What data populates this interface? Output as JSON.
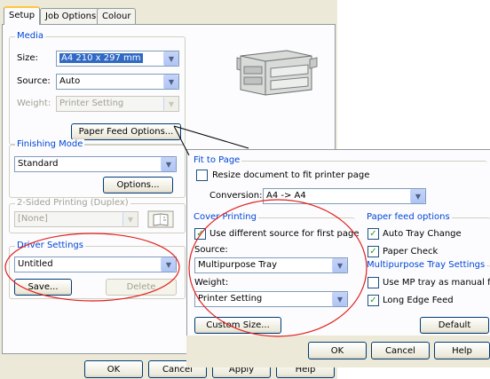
{
  "tabs": [
    {
      "label": "Setup",
      "active": true
    },
    {
      "label": "Job Options",
      "active": false
    },
    {
      "label": "Colour",
      "active": false
    }
  ],
  "media": {
    "group_label": "Media",
    "size_label": "Size:",
    "size_value": "A4 210 x 297 mm",
    "source_label": "Source:",
    "source_value": "Auto",
    "weight_label": "Weight:",
    "weight_value": "Printer Setting",
    "paper_feed_button": "Paper Feed Options..."
  },
  "finishing": {
    "group_label": "Finishing Mode",
    "value": "Standard",
    "options_button": "Options..."
  },
  "duplex": {
    "group_label": "2-Sided Printing (Duplex)",
    "value": "[None]"
  },
  "driver_settings": {
    "group_label": "Driver Settings",
    "value": "Untitled",
    "save_button": "Save...",
    "delete_button": "Delete"
  },
  "main_buttons": {
    "ok": "OK",
    "cancel": "Cancel",
    "apply": "Apply",
    "help": "Help"
  },
  "paper_feed_dialog": {
    "fit_to_page": {
      "group_label": "Fit to Page",
      "resize_label": "Resize document to fit printer page",
      "resize_checked": false,
      "conversion_label": "Conversion:",
      "conversion_value": "A4 -> A4"
    },
    "cover_printing": {
      "group_label": "Cover Printing",
      "use_different_label": "Use different source for first page",
      "use_different_checked": true,
      "source_label": "Source:",
      "source_value": "Multipurpose Tray",
      "weight_label": "Weight:",
      "weight_value": "Printer Setting"
    },
    "paper_feed_options": {
      "group_label": "Paper feed options",
      "auto_tray_change": "Auto Tray Change",
      "auto_tray_change_checked": true,
      "paper_check": "Paper Check",
      "paper_check_checked": true
    },
    "mp_tray": {
      "group_label": "Multipurpose Tray Settings",
      "use_mp_manual": "Use MP tray as manual feed",
      "use_mp_manual_checked": false,
      "long_edge_feed": "Long Edge Feed",
      "long_edge_feed_checked": true
    },
    "custom_size_button": "Custom Size...",
    "default_button": "Default",
    "ok_button": "OK",
    "cancel_button": "Cancel",
    "help_button": "Help"
  },
  "icons": {
    "checkmark": "✓",
    "dropdown_arrow": "▼",
    "duplex_book": "duplex-book-icon",
    "printer": "printer-icon"
  },
  "colors": {
    "group_label_blue": "#0046d5",
    "highlight_red": "#e0201c",
    "selection_blue": "#316ac5",
    "tab_accent": "#ffc83c"
  }
}
